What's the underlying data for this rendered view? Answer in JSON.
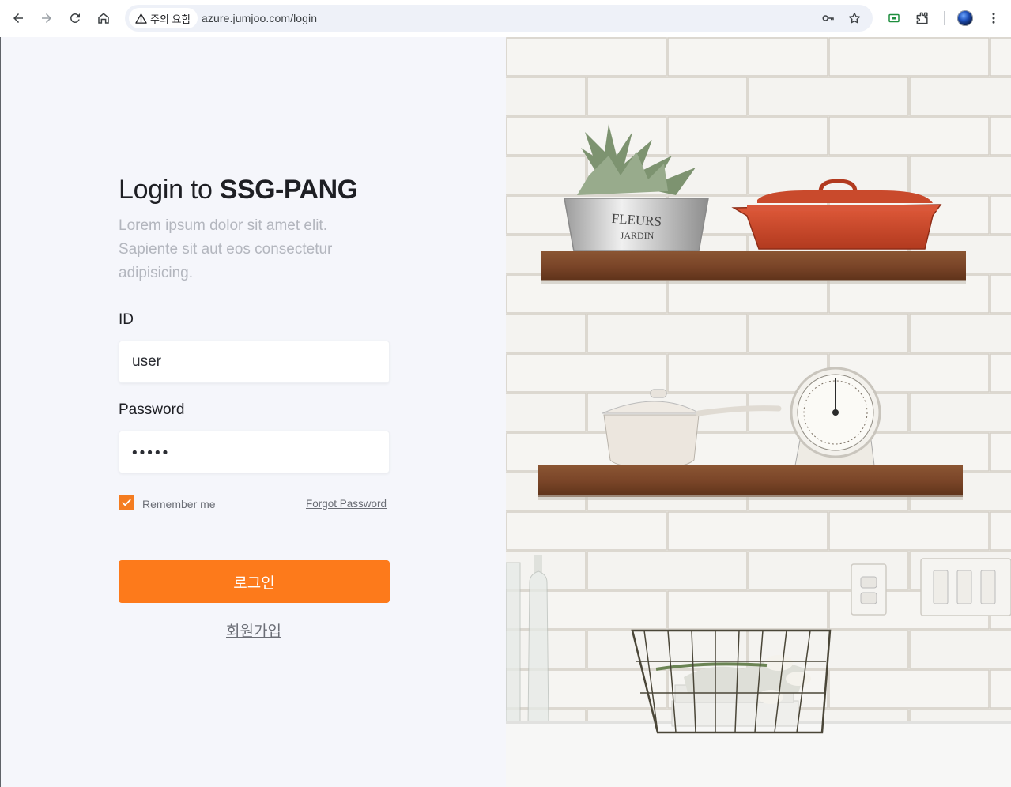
{
  "browser": {
    "security_chip": "주의 요함",
    "url": "azure.jumjoo.com/login",
    "icons": [
      "back-icon",
      "forward-icon",
      "reload-icon",
      "home-icon",
      "warning-icon",
      "key-icon",
      "star-icon",
      "extension-badge-icon",
      "puzzle-icon",
      "profile-avatar",
      "kebab-menu-icon"
    ]
  },
  "login": {
    "title_prefix": "Login to ",
    "title_brand": "SSG-PANG",
    "subtitle": "Lorem ipsum dolor sit amet elit. Sapiente sit aut eos consectetur adipisicing.",
    "id_label": "ID",
    "id_value": "user",
    "password_label": "Password",
    "password_mask": "•••••",
    "remember_label": "Remember me",
    "remember_checked": true,
    "forgot_label": "Forgot Password",
    "submit_label": "로그인",
    "signup_label": "회원가입"
  },
  "colors": {
    "accent": "#fd7a1b",
    "checkbox": "#f47c20",
    "pane_bg": "#f5f6fb",
    "muted_text": "#b3b6be"
  }
}
